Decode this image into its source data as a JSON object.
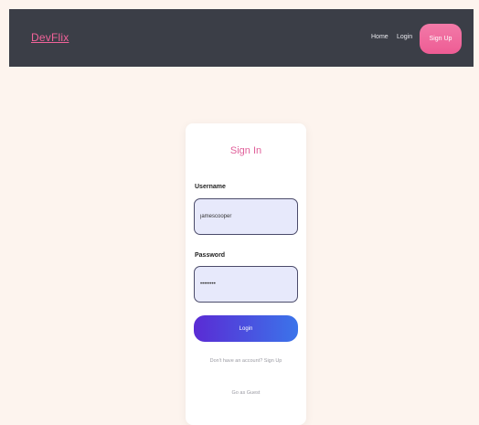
{
  "navbar": {
    "brand": "DevFlix",
    "links": [
      "Home",
      "Login"
    ],
    "signup_button": "Sign Up"
  },
  "login_card": {
    "title": "Sign In",
    "username_label": "Username",
    "username_value": "jamescooper",
    "password_label": "Password",
    "password_value": "••••••••",
    "submit_label": "Login",
    "signup_prompt": "Don't have an account? Sign Up",
    "guest_link": "Go as Guest"
  },
  "colors": {
    "navbar_bg": "#3b3e47",
    "brand": "#f2639a",
    "page_bg": "#fdf4ee",
    "accent_pink": "#ee5c94",
    "button_gradient_start": "#5a2bd4",
    "button_gradient_end": "#3b74ea",
    "input_bg": "#e7e9fb"
  }
}
